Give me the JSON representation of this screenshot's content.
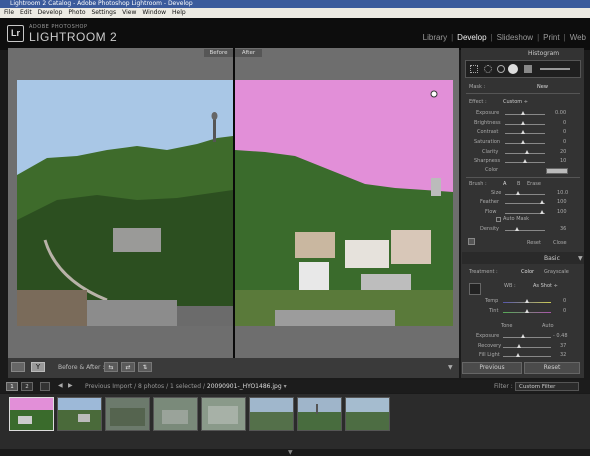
{
  "window": {
    "title": "Lightroom 2 Catalog - Adobe Photoshop Lightroom - Develop"
  },
  "menu": [
    "File",
    "Edit",
    "Develop",
    "Photo",
    "Settings",
    "View",
    "Window",
    "Help"
  ],
  "brand": {
    "badge": "Lr",
    "top": "ADOBE PHOTOSHOP",
    "main": "LIGHTROOM 2"
  },
  "modules": [
    "Library",
    "Develop",
    "Slideshow",
    "Print",
    "Web"
  ],
  "active_module": "Develop",
  "compare": {
    "before": "Before",
    "after": "After"
  },
  "toolbar": {
    "before_after": "Before & After :"
  },
  "right": {
    "histogram": "Histogram",
    "mask": "Mask :",
    "mask_new": "New",
    "effect": "Effect :",
    "effect_val": "Custom ÷",
    "effect_rows": [
      {
        "label": "Exposure",
        "value": "0.00"
      },
      {
        "label": "Brightness",
        "value": "0"
      },
      {
        "label": "Contrast",
        "value": "0"
      },
      {
        "label": "Saturation",
        "value": "0"
      },
      {
        "label": "Clarity",
        "value": "20"
      },
      {
        "label": "Sharpness",
        "value": "10"
      },
      {
        "label": "Color",
        "value": ""
      }
    ],
    "brush": "Brush :",
    "brush_a": "A",
    "brush_b": "B",
    "brush_erase": "Erase",
    "brush_rows": [
      {
        "label": "Size",
        "value": "10.0"
      },
      {
        "label": "Feather",
        "value": "100"
      },
      {
        "label": "Flow",
        "value": "100"
      }
    ],
    "automask": "Auto Mask",
    "density": "Density",
    "density_val": "36",
    "reset": "Reset",
    "close": "Close",
    "basic": "Basic",
    "treatment": "Treatment :",
    "color": "Color",
    "grayscale": "Grayscale",
    "wb": "WB :",
    "wb_val": "As Shot ÷",
    "temp": "Temp",
    "temp_val": "0",
    "tint": "Tint",
    "tint_val": "0",
    "tone": "Tone",
    "auto": "Auto",
    "tone_rows": [
      {
        "label": "Exposure",
        "value": "- 0.48"
      },
      {
        "label": "Recovery",
        "value": "37"
      },
      {
        "label": "Fill Light",
        "value": "32"
      }
    ],
    "previous": "Previous",
    "reset_btn": "Reset"
  },
  "filmstrip": {
    "page1": "1",
    "page2": "2",
    "path_prefix": "Previous Import / 8 photos / 1 selected / ",
    "path_file": "20090901-_HYO1486.jpg",
    "filter": "Filter :",
    "filter_val": "Custom Filter"
  },
  "colors": {
    "pink_sky": "#e28fd8",
    "blue_sky": "#a8c6e6",
    "active_accent": "#eeeeee"
  }
}
